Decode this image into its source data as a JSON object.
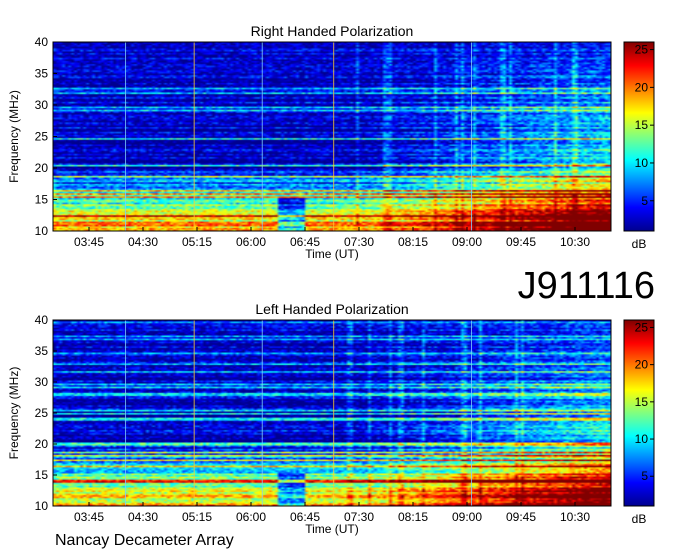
{
  "figure_id": "J911116",
  "footer": "Nancay Decameter Array",
  "colorbar": {
    "colors": [
      "#00008f",
      "#0000ff",
      "#0080ff",
      "#00ffff",
      "#80ff80",
      "#ffff00",
      "#ff8000",
      "#ff0000",
      "#800000"
    ],
    "unit": "dB"
  },
  "chart_data": [
    {
      "type": "heatmap",
      "title": "Right Handed Polarization",
      "xlabel": "Time (UT)",
      "ylabel": "Frequency (MHz)",
      "x_ticks": [
        "03:45",
        "04:30",
        "05:15",
        "06:00",
        "06:45",
        "07:30",
        "08:15",
        "09:00",
        "09:45",
        "10:30"
      ],
      "x_tick_minutes": [
        225,
        270,
        315,
        360,
        405,
        450,
        495,
        540,
        585,
        630
      ],
      "xlim_minutes": [
        195,
        660
      ],
      "y_ticks": [
        10,
        15,
        20,
        25,
        30,
        35,
        40
      ],
      "ylim": [
        10,
        40
      ],
      "colorbar_ticks": [
        5,
        10,
        15,
        20,
        25
      ],
      "clim": [
        1,
        26
      ],
      "unit": "dB"
    },
    {
      "type": "heatmap",
      "title": "Left Handed Polarization",
      "xlabel": "Time (UT)",
      "ylabel": "Frequency (MHz)",
      "x_ticks": [
        "03:45",
        "04:30",
        "05:15",
        "06:00",
        "06:45",
        "07:30",
        "08:15",
        "09:00",
        "09:45",
        "10:30"
      ],
      "x_tick_minutes": [
        225,
        270,
        315,
        360,
        405,
        450,
        495,
        540,
        585,
        630
      ],
      "xlim_minutes": [
        195,
        660
      ],
      "y_ticks": [
        10,
        15,
        20,
        25,
        30,
        35,
        40
      ],
      "ylim": [
        10,
        40
      ],
      "colorbar_ticks": [
        5,
        10,
        15,
        20,
        25
      ],
      "clim": [
        1,
        26
      ],
      "unit": "dB"
    }
  ]
}
